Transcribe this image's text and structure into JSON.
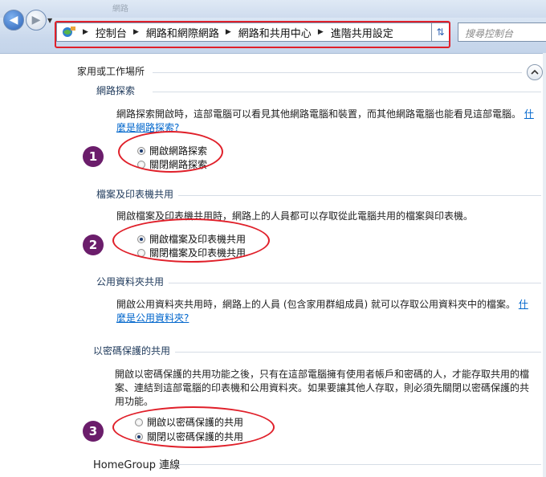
{
  "window": {
    "title_faint": "網路"
  },
  "address_bar": {
    "crumbs": [
      "控制台",
      "網路和網際網路",
      "網路和共用中心",
      "進階共用設定"
    ]
  },
  "search": {
    "placeholder": "搜尋控制台"
  },
  "profile_heading": "家用或工作場所",
  "sections": {
    "network_discovery": {
      "heading": "網路探索",
      "description": "網路探索開啟時，這部電腦可以看見其他網路電腦和裝置，而其他網路電腦也能看見這部電腦。",
      "link": "什麼是網路探索?",
      "options": [
        "開啟網路探索",
        "關閉網路探索"
      ],
      "selected": 0,
      "marker": "1"
    },
    "file_printer_sharing": {
      "heading": "檔案及印表機共用",
      "description": "開啟檔案及印表機共用時，網路上的人員都可以存取從此電腦共用的檔案與印表機。",
      "options": [
        "開啟檔案及印表機共用",
        "關閉檔案及印表機共用"
      ],
      "selected": 0,
      "marker": "2"
    },
    "public_folder_sharing": {
      "heading": "公用資料夾共用",
      "description": "開啟公用資料夾共用時，網路上的人員 (包含家用群組成員) 就可以存取公用資料夾中的檔案。",
      "link": "什麼是公用資料夾?"
    },
    "password_protected_sharing": {
      "heading": "以密碼保護的共用",
      "description_line1": "開啟以密碼保護的共用功能之後，只有在這部電腦擁有使用者帳戶和密碼的人，才能存取共用的檔",
      "description_line2": "案、連結到這部電腦的印表機和公用資料夾。如果要讓其他人存取，則必須先關閉以密碼保護的共",
      "description_line3": "用功能。",
      "options": [
        "開啟以密碼保護的共用",
        "關閉以密碼保護的共用"
      ],
      "selected": 1,
      "marker": "3"
    },
    "homegroup": {
      "heading": "HomeGroup 連線"
    }
  },
  "colors": {
    "annotation_red": "#e0202a",
    "marker_purple": "#6b1d6b",
    "link_blue": "#0066cc"
  }
}
